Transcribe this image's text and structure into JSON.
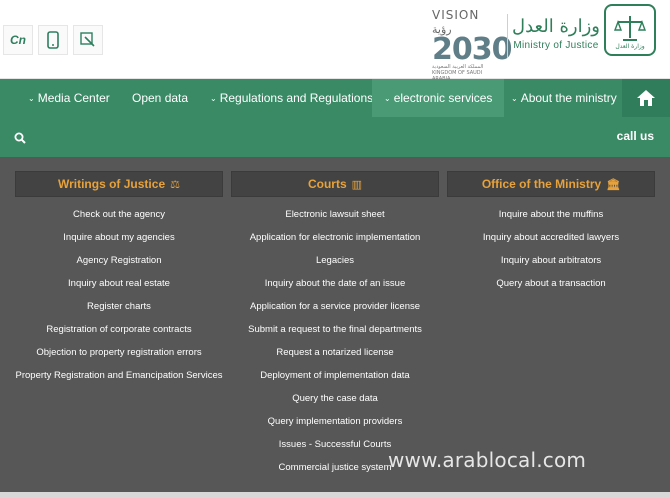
{
  "header": {
    "vision_label": "VISION",
    "vision_year": "2030",
    "vision_arabic": "رؤية",
    "vision_sub": "المملكة العربية السعودية KINGDOM OF SAUDI ARABIA",
    "ministry_arabic": "وزارة العدل",
    "ministry_english": "Ministry of Justice",
    "emblem_arabic": "وزارة العدل",
    "tools": [
      {
        "name": "text-size-icon",
        "glyph": "Cn"
      },
      {
        "name": "mobile-icon",
        "glyph": "▯"
      },
      {
        "name": "zoom-icon",
        "glyph": "⌕"
      }
    ]
  },
  "nav": {
    "items": [
      {
        "label": "Media Center",
        "caret": "⌄"
      },
      {
        "label": "Open data",
        "caret": ""
      },
      {
        "label": "Regulations and Regulations",
        "caret": "⌄"
      },
      {
        "label": "electronic services",
        "caret": "⌄"
      },
      {
        "label": "About the ministry",
        "caret": "⌄"
      }
    ],
    "call_us": "call us"
  },
  "dropdown": {
    "columns": [
      {
        "title": "Writings of Justice",
        "icon": "⚖",
        "links": [
          "Check out the agency",
          "Inquire about my agencies",
          "Agency Registration",
          "Inquiry about real estate",
          "Register charts",
          "Registration of corporate contracts",
          "Objection to property registration errors",
          "Property Registration and Emancipation Services"
        ]
      },
      {
        "title": "Courts",
        "icon": "▥",
        "links": [
          "Electronic lawsuit sheet",
          "Application for electronic implementation",
          "Legacies",
          "Inquiry about the date of an issue",
          "Application for a service provider license",
          "Submit a request to the final departments",
          "Request a notarized license",
          "Deployment of implementation data",
          "Query the case data",
          "Query implementation providers",
          "Issues - Successful Courts",
          "Commercial justice system"
        ]
      },
      {
        "title": "Office of the Ministry",
        "icon": "🏛",
        "links": [
          "Inquire about the muffins",
          "Inquiry about accredited lawyers",
          "Inquiry about arbitrators",
          "Query about a transaction"
        ]
      }
    ]
  },
  "watermark": "www.arablocal.com",
  "colors": {
    "nav_green": "#3a8a66",
    "accent_orange": "#e7a23b",
    "dropdown_gray": "#575757"
  }
}
